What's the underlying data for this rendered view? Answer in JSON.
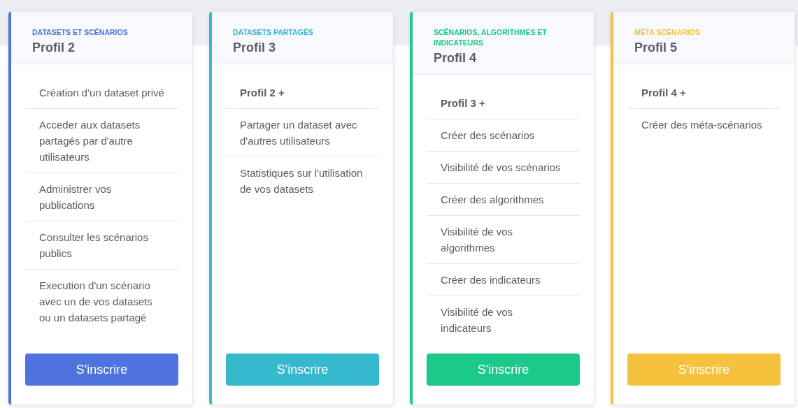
{
  "cards": [
    {
      "category": "DATASETS ET SCÉNARIOS",
      "title": "Profil 2",
      "color": "#4e73df",
      "features": [
        {
          "text": "Création d'un dataset privé",
          "kind": "plain"
        },
        {
          "text": "Acceder aux datasets partagés par d'autre utilisateurs",
          "kind": "plain"
        },
        {
          "text": "Administrer vos publications",
          "kind": "plain"
        },
        {
          "text": "Consulter les scénarios publics",
          "kind": "plain"
        },
        {
          "text": "Execution d'un scénario avec un de vos datasets ou un datasets partagé",
          "kind": "plain"
        }
      ],
      "button": "S'inscrire"
    },
    {
      "category": "DATASETS PARTAGÉS",
      "title": "Profil 3",
      "color": "#36b9cc",
      "features": [
        {
          "text": "Profil 2 +",
          "kind": "bold"
        },
        {
          "text": "Partager un dataset avec d'autres utilisateurs",
          "kind": "plain"
        },
        {
          "text": "Statistiques sur l'utilisation de vos datasets",
          "kind": "plain"
        }
      ],
      "button": "S'inscrire"
    },
    {
      "category": "SCÉNARIOS, ALGORITHMES ET INDICATEURS",
      "title": "Profil 4",
      "color": "#1cc88a",
      "features": [
        {
          "text": "Profil 3 +",
          "kind": "bold"
        },
        {
          "text": "Créer des scénarios",
          "kind": "plain"
        },
        {
          "text": "Visibilité de vos scénarios",
          "kind": "plain"
        },
        {
          "text": "Créer des algorithmes",
          "kind": "plain"
        },
        {
          "text": "Visibilité de vos algorithmes",
          "kind": "plain"
        },
        {
          "text": "Créer des indicateurs",
          "kind": "plain"
        },
        {
          "text": "Visibilité de vos indicateurs",
          "kind": "plain"
        }
      ],
      "button": "S'inscrire"
    },
    {
      "category": "MÉTA SCÉNARIOS",
      "title": "Profil 5",
      "color": "#f6c23e",
      "features": [
        {
          "text": "Profil 4 +",
          "kind": "bold"
        },
        {
          "text": "Créer des méta-scénarios",
          "kind": "plain"
        }
      ],
      "button": "S'inscrire"
    }
  ]
}
